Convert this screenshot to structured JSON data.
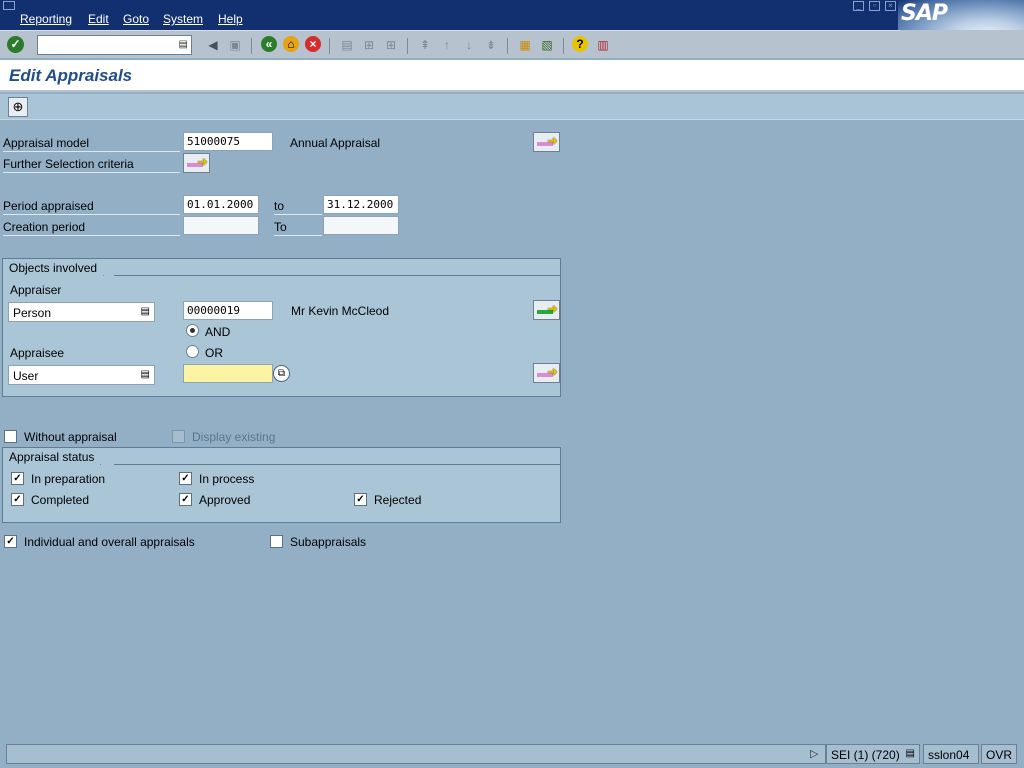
{
  "menu": {
    "items": [
      {
        "label": "Reporting"
      },
      {
        "label": "Edit"
      },
      {
        "label": "Goto"
      },
      {
        "label": "System"
      },
      {
        "label": "Help"
      }
    ],
    "logo_text": "SAP"
  },
  "toolbar": {
    "command_field_value": ""
  },
  "page": {
    "title": "Edit Appraisals"
  },
  "form": {
    "appraisal_model_label": "Appraisal model",
    "appraisal_model_value": "51000075",
    "appraisal_model_text": "Annual Appraisal",
    "further_selection_label": "Further Selection criteria",
    "period_appraised_label": "Period appraised",
    "period_from": "01.01.2000",
    "period_to_label": "to",
    "period_to": "31.12.2000",
    "creation_period_label": "Creation period",
    "creation_from": "",
    "creation_to_label": "To",
    "creation_to": ""
  },
  "objects": {
    "title": "Objects involved",
    "appraiser_label": "Appraiser",
    "appraiser_type": "Person",
    "appraiser_id": "00000019",
    "appraiser_name": "Mr Kevin McCleod",
    "and_label": "AND",
    "or_label": "OR",
    "and_selected": true,
    "appraisee_label": "Appraisee",
    "appraisee_type": "User",
    "appraisee_id": ""
  },
  "options": {
    "without_appraisal_label": "Without appraisal",
    "display_existing_label": "Display existing"
  },
  "status": {
    "title": "Appraisal status",
    "in_preparation": "In preparation",
    "in_process": "In process",
    "completed": "Completed",
    "approved": "Approved",
    "rejected": "Rejected"
  },
  "bottom": {
    "individual_label": "Individual and overall appraisals",
    "subappraisals_label": "Subappraisals"
  },
  "statusbar": {
    "session": "SEI (1) (720)",
    "server": "sslon04",
    "mode": "OVR"
  },
  "icons": {
    "check": "✓",
    "dropdown": "▤",
    "arrow": "➜",
    "execute": "⊕",
    "search_help": "⧉"
  }
}
